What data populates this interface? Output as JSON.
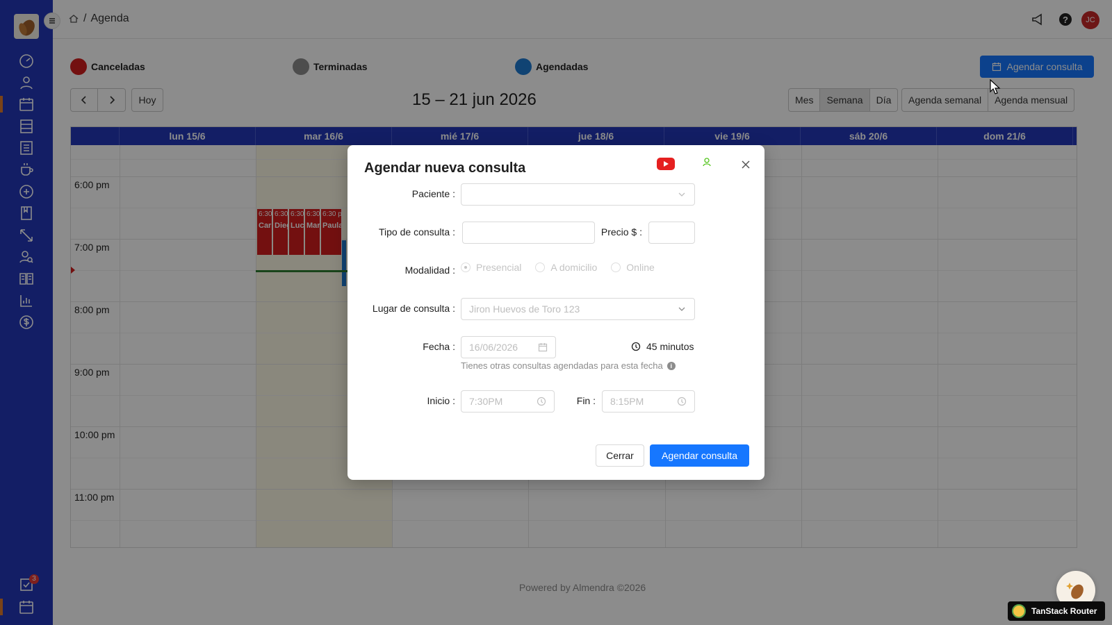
{
  "header": {
    "breadcrumb_current": "Agenda",
    "avatar_initials": "JC"
  },
  "legend": [
    {
      "label": "Canceladas",
      "color": "#d21e1e"
    },
    {
      "label": "Terminadas",
      "color": "#8c8c8c"
    },
    {
      "label": "Agendadas",
      "color": "#1e7ad2"
    }
  ],
  "toolbar": {
    "new_appointment": "Agendar consulta",
    "today": "Hoy",
    "range_title": "15 – 21 jun 2026",
    "views": [
      "Mes",
      "Semana",
      "Día"
    ],
    "active_view": "Semana",
    "agenda_views": [
      "Agenda semanal",
      "Agenda mensual"
    ]
  },
  "calendar": {
    "days": [
      "lun 15/6",
      "mar 16/6",
      "mié 17/6",
      "jue 18/6",
      "vie 19/6",
      "sáb 20/6",
      "dom 21/6"
    ],
    "times": [
      "6:00 pm",
      "7:00 pm",
      "8:00 pm",
      "9:00 pm",
      "10:00 pm",
      "11:00 pm"
    ],
    "events": [
      {
        "time": "6:30",
        "name": "Carl"
      },
      {
        "time": "6:30",
        "name": "Dieg"
      },
      {
        "time": "6:30",
        "name": "Luci"
      },
      {
        "time": "6:30",
        "name": "Mar"
      },
      {
        "time": "6:30 p",
        "name": "Paula"
      }
    ]
  },
  "modal": {
    "title": "Agendar nueva consulta",
    "labels": {
      "paciente": "Paciente :",
      "tipo": "Tipo de consulta :",
      "precio": "Precio $ :",
      "modalidad": "Modalidad :",
      "lugar": "Lugar de consulta :",
      "fecha": "Fecha :",
      "inicio": "Inicio :",
      "fin": "Fin :"
    },
    "modalidad_options": [
      "Presencial",
      "A domicilio",
      "Online"
    ],
    "lugar_value": "Jiron Huevos de Toro 123",
    "fecha_value": "16/06/2026",
    "duration": "45 minutos",
    "hint": "Tienes otras consultas agendadas para esta fecha",
    "inicio_value": "7:30PM",
    "fin_value": "8:15PM",
    "cancel": "Cerrar",
    "submit": "Agendar consulta"
  },
  "footer": "Powered by Almendra ©2026",
  "tanstack_label": "TanStack Router",
  "sidebar_badge": "3"
}
